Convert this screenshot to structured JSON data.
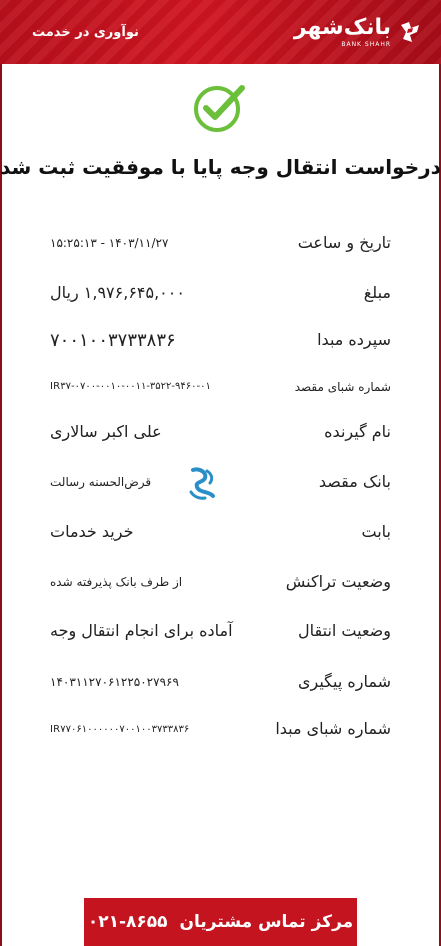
{
  "header": {
    "brand_name": "بانک‌شهر",
    "brand_latin": "BANK SHAHR",
    "slogan": "نوآوری در خدمت"
  },
  "title": "درخواست انتقال وجه پایا با موفقیت ثبت شد",
  "details": [
    {
      "label": "تاریخ و ساعت",
      "value": "۱۴۰۳/۱۱/۲۷ - ۱۵:۲۵:۱۳"
    },
    {
      "label": "مبلغ",
      "value": "۱,۹۷۶,۶۴۵,۰۰۰ ریال"
    },
    {
      "label": "سپرده مبدا",
      "value": "۷۰۰۱۰۰۳۷۳۳۸۳۶"
    },
    {
      "label": "شماره شبای مقصد",
      "value": "IR۳۷-۰۷۰۰-۰۰۱۰-۰۰۱۱-۳۵۲۲-۹۴۶۰-۰۱"
    },
    {
      "label": "نام گیرنده",
      "value": "علی اکبر سالاری"
    },
    {
      "label": "بانک مقصد",
      "value": "قرض‌الحسنه رسالت"
    },
    {
      "label": "بابت",
      "value": "خرید خدمات"
    },
    {
      "label": "وضعیت تراکنش",
      "value": "از طرف بانک پذیرفته شده"
    },
    {
      "label": "وضعیت انتقال",
      "value": "آماده برای انجام انتقال وجه"
    },
    {
      "label": "شماره پیگیری",
      "value": "۱۴۰۳۱۱۲۷۰۶۱۲۲۵۰۲۷۹۶۹"
    },
    {
      "label": "شماره شبای مبدا",
      "value": "IR۷۷۰۶۱۰۰۰۰۰۰۷۰۰۱۰۰۳۷۳۳۸۳۶"
    }
  ],
  "footer": {
    "label": "مرکز تماس مشتریان",
    "phone": "۰۲۱-۸۶۵۵"
  },
  "colors": {
    "brand_red": "#c41420",
    "success_green": "#6cbf3a",
    "bank_logo_blue": "#2a8fc9"
  },
  "icons": {
    "success": "check-circle-icon",
    "destination_bank": "resalat-bank-logo"
  }
}
